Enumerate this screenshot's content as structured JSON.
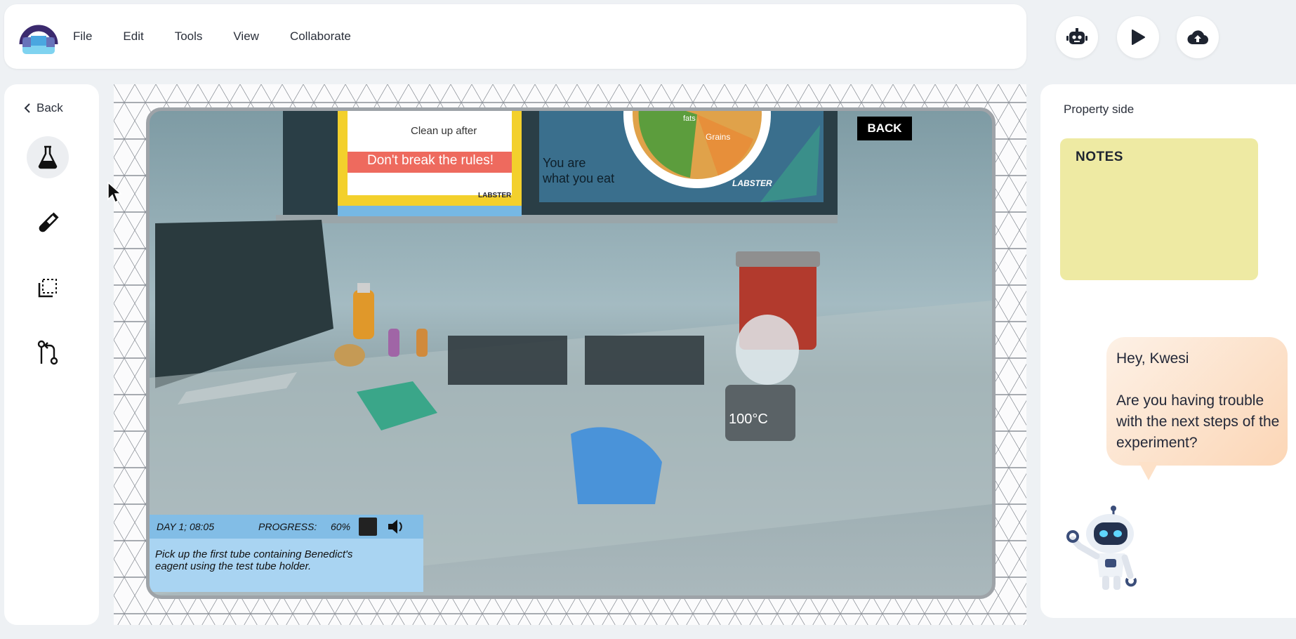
{
  "topbar": {
    "menu": [
      "File",
      "Edit",
      "Tools",
      "View",
      "Collaborate"
    ],
    "actions": [
      {
        "name": "assistant-bot-button",
        "icon": "robot-icon"
      },
      {
        "name": "play-button",
        "icon": "play-icon"
      },
      {
        "name": "upload-button",
        "icon": "cloud-upload-icon"
      }
    ]
  },
  "sidebar": {
    "back_label": "Back",
    "tools": [
      {
        "name": "flask-tool",
        "icon": "flask-icon",
        "active": true
      },
      {
        "name": "test-tube-tool",
        "icon": "test-tube-icon",
        "active": false
      },
      {
        "name": "select-tool",
        "icon": "selection-icon",
        "active": false
      },
      {
        "name": "branch-tool",
        "icon": "git-branch-icon",
        "active": false
      }
    ]
  },
  "scene": {
    "poster_left_lines": [
      "Clean up after",
      "Don't break the rules!",
      "LABSTER"
    ],
    "poster_right_lines": [
      "You are",
      "what you eat",
      "LABSTER",
      "Grains",
      "fats"
    ],
    "back_button": "BACK",
    "heater_temp": "100°C",
    "hud": {
      "day_time": "DAY 1; 08:05",
      "progress_label": "PROGRESS:",
      "progress_value": "60%",
      "instruction": "Pick up the first tube containing Benedict's eagent using the test tube holder."
    }
  },
  "right_panel": {
    "title": "Property side",
    "notes_title": "NOTES",
    "chat_greeting": "Hey, Kwesi",
    "chat_message": "Are you having trouble with the next steps of the experiment?"
  },
  "colors": {
    "notes_bg": "#eeeaa3",
    "bubble_start": "#fdf1e6",
    "bubble_end": "#fcd6b6",
    "hud_bg": "#a9d4f2"
  }
}
